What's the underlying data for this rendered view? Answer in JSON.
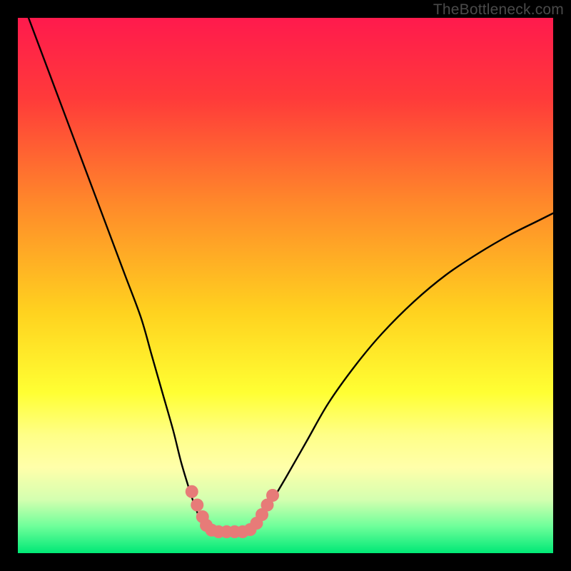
{
  "watermark": "TheBottleneck.com",
  "chart_data": {
    "type": "line",
    "title": "",
    "xlabel": "",
    "ylabel": "",
    "xlim": [
      0,
      100
    ],
    "ylim": [
      0,
      100
    ],
    "background_gradient": {
      "stops": [
        {
          "offset": 0.0,
          "color": "#ff1a4d"
        },
        {
          "offset": 0.15,
          "color": "#ff3a3a"
        },
        {
          "offset": 0.35,
          "color": "#ff8a2a"
        },
        {
          "offset": 0.55,
          "color": "#ffd21f"
        },
        {
          "offset": 0.7,
          "color": "#ffff33"
        },
        {
          "offset": 0.78,
          "color": "#ffff88"
        },
        {
          "offset": 0.84,
          "color": "#ffffaa"
        },
        {
          "offset": 0.9,
          "color": "#d4ffb0"
        },
        {
          "offset": 0.95,
          "color": "#6eff9a"
        },
        {
          "offset": 1.0,
          "color": "#00e876"
        }
      ]
    },
    "series": [
      {
        "name": "bottleneck-curve",
        "color": "#000000",
        "x": [
          2,
          5,
          8,
          11,
          14,
          17,
          20,
          23,
          25,
          27,
          29,
          30.5,
          32,
          33,
          34,
          35,
          36,
          38,
          42,
          43.5,
          45,
          47,
          50,
          54,
          58,
          63,
          68,
          74,
          80,
          86,
          92,
          97,
          100
        ],
        "y": [
          100,
          92,
          84,
          76,
          68,
          60,
          52,
          44,
          37,
          30,
          23,
          17,
          12,
          9,
          6.5,
          5,
          4.2,
          4,
          4,
          4.5,
          6,
          9,
          14,
          21,
          28,
          35,
          41,
          47,
          52,
          56,
          59.5,
          62,
          63.5
        ]
      }
    ],
    "markers": {
      "name": "highlight-points",
      "color": "#e77b78",
      "radius": 9,
      "points": [
        {
          "x": 32.5,
          "y": 11.5
        },
        {
          "x": 33.5,
          "y": 9
        },
        {
          "x": 34.5,
          "y": 6.8
        },
        {
          "x": 35.2,
          "y": 5.2
        },
        {
          "x": 36.2,
          "y": 4.3
        },
        {
          "x": 37.5,
          "y": 4.0
        },
        {
          "x": 39.0,
          "y": 4.0
        },
        {
          "x": 40.5,
          "y": 4.0
        },
        {
          "x": 42.0,
          "y": 4.0
        },
        {
          "x": 43.4,
          "y": 4.4
        },
        {
          "x": 44.6,
          "y": 5.6
        },
        {
          "x": 45.6,
          "y": 7.2
        },
        {
          "x": 46.6,
          "y": 9.0
        },
        {
          "x": 47.6,
          "y": 10.8
        }
      ]
    }
  }
}
